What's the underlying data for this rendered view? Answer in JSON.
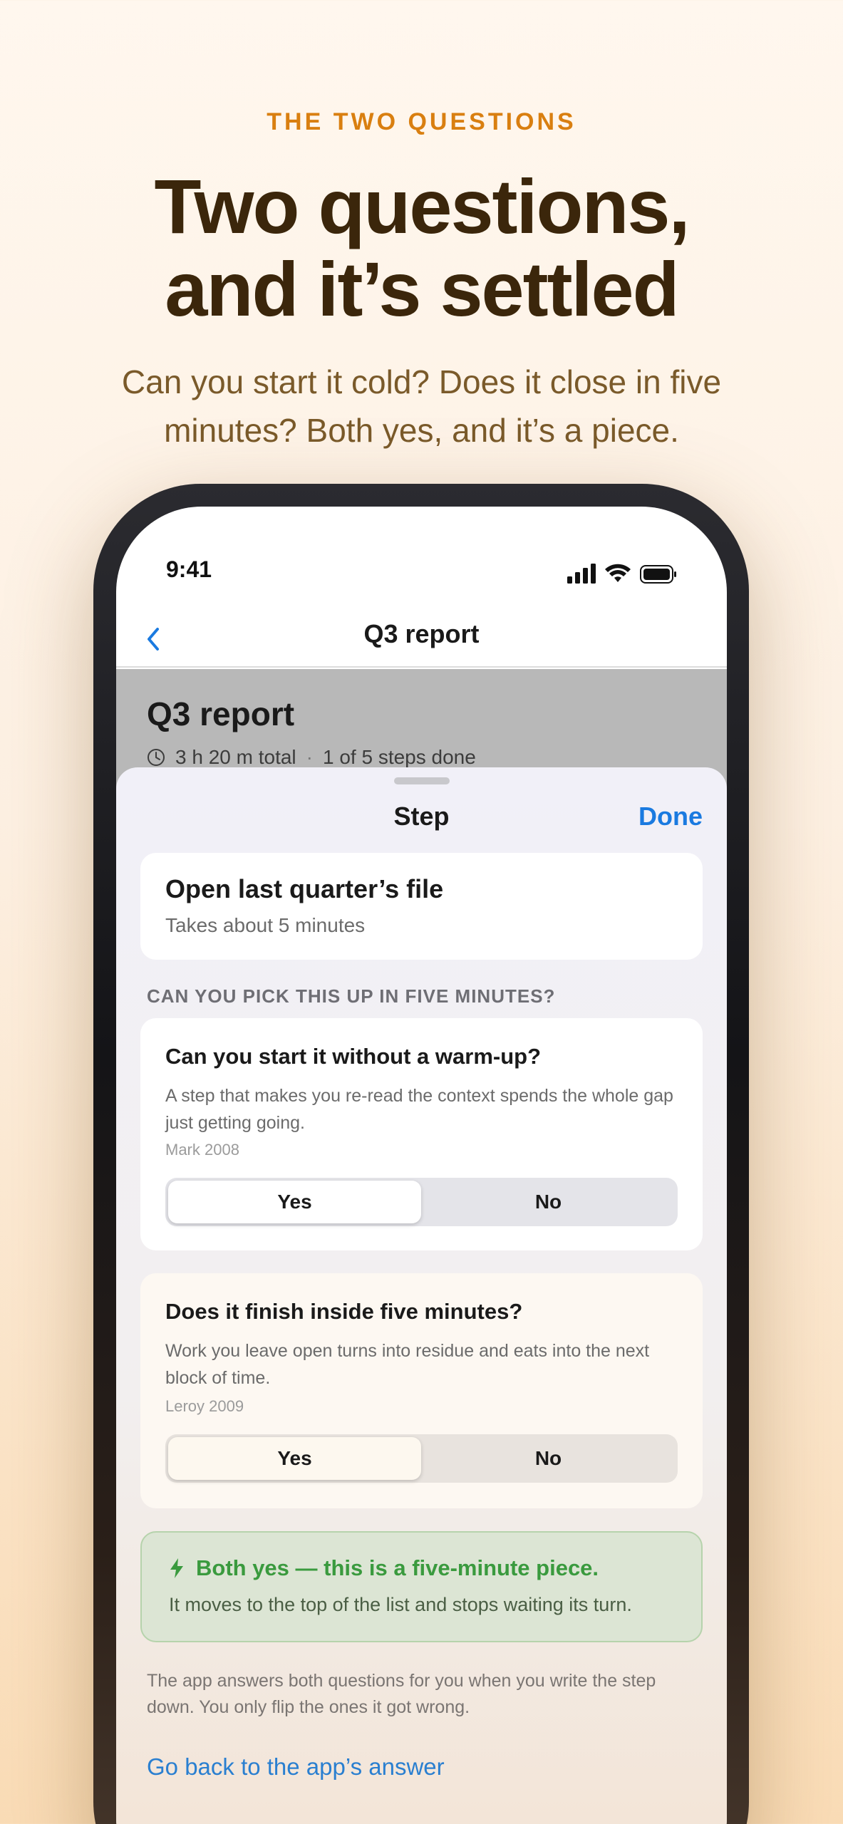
{
  "hero": {
    "eyebrow": "THE TWO QUESTIONS",
    "headline_line1": "Two questions,",
    "headline_line2": "and it’s settled",
    "subtitle": "Can you start it cold? Does it close in five minutes? Both yes, and it’s a piece."
  },
  "status_bar": {
    "time": "9:41",
    "icons": [
      "signal-icon",
      "wifi-icon",
      "battery-icon"
    ]
  },
  "nav": {
    "back_icon": "chevron-left-icon",
    "title": "Q3 report"
  },
  "background_page": {
    "title": "Q3 report",
    "total": "3 h 20 m total",
    "separator": "·",
    "progress": "1 of 5 steps done"
  },
  "sheet": {
    "title": "Step",
    "done_label": "Done",
    "step": {
      "title": "Open last quarter’s file",
      "subtitle": "Takes about 5 minutes"
    },
    "section_label": "CAN YOU PICK THIS UP IN FIVE MINUTES?",
    "questions": [
      {
        "title": "Can you start it without a warm-up?",
        "body": "A step that makes you re-read the context spends the whole gap just getting going.",
        "citation": "Mark 2008",
        "options": [
          "Yes",
          "No"
        ],
        "selected": "Yes"
      },
      {
        "title": "Does it finish inside five minutes?",
        "body": "Work you leave open turns into residue and eats into the next block of time.",
        "citation": "Leroy 2009",
        "options": [
          "Yes",
          "No"
        ],
        "selected": "Yes"
      }
    ],
    "result": {
      "icon": "bolt-icon",
      "title": "Both yes — this is a five-minute piece.",
      "body": "It moves to the top of the list and stops waiting its turn.",
      "accent_color": "#3a9a3e"
    },
    "footnote": "The app answers both questions for you when you write the step down. You only flip the ones it got wrong.",
    "revert_link": "Go back to the app’s answer"
  },
  "colors": {
    "accent_orange": "#d97f10",
    "headline_brown": "#3b260b",
    "link_blue": "#1a7ae0"
  }
}
